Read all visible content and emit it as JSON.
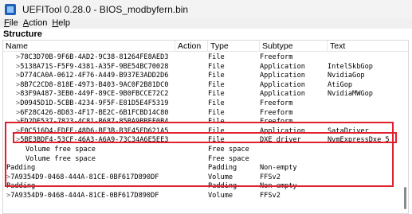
{
  "window": {
    "title": "UEFITool 0.28.0 - BIOS_modbyfern.bin"
  },
  "menu": [
    {
      "underline": "F",
      "rest": "ile"
    },
    {
      "underline": "A",
      "rest": "ction"
    },
    {
      "underline": "H",
      "rest": "elp"
    }
  ],
  "structure_label": "Structure",
  "columns": {
    "name": "Name",
    "action": "Action",
    "type": "Type",
    "subtype": "Subtype",
    "text": "Text"
  },
  "rows": [
    {
      "arrow": ">",
      "name": "78C3D70B-9F6B-4AD2-9C38-81264FE8AED3",
      "action": "",
      "type": "File",
      "subtype": "Freeform",
      "text": ""
    },
    {
      "arrow": ">",
      "name": "5138A71S-F5F9-4381-A35F-9BE54BC70028",
      "action": "",
      "type": "File",
      "subtype": "Application",
      "text": "IntelSkbGop"
    },
    {
      "arrow": ">",
      "name": "D774CA0A-0612-4F76-A449-B937E3ADD2D6",
      "action": "",
      "type": "File",
      "subtype": "Application",
      "text": "NvidiaGop"
    },
    {
      "arrow": ">",
      "name": "8B7C2CD8-818E-4973-B403-9AC0F2B81DC0",
      "action": "",
      "type": "File",
      "subtype": "Application",
      "text": "AtiGop"
    },
    {
      "arrow": ">",
      "name": "83F9A487-3EB0-449F-89CE-9B0FBCCE72C2",
      "action": "",
      "type": "File",
      "subtype": "Application",
      "text": "NvidiaMWGop"
    },
    {
      "arrow": ">",
      "name": "D0945D1D-5CBB-4234-9F5F-E81D5E4F5319",
      "action": "",
      "type": "File",
      "subtype": "Freeform",
      "text": ""
    },
    {
      "arrow": ">",
      "name": "6F28C426-8D83-4F17-BE2C-6B1FCBD14C80",
      "action": "",
      "type": "File",
      "subtype": "Freeform",
      "text": ""
    },
    {
      "arrow": ">",
      "name": "ED2DE537-7823-4C81-B687-85BA9BBEF0B4",
      "action": "",
      "type": "File",
      "subtype": "Freeform",
      "text": ""
    },
    {
      "arrow": ">",
      "name": "F0C516D4-EDFF-48D6-BF3B-B3E45FD621A5",
      "action": "",
      "type": "File",
      "subtype": "Application",
      "text": "SataDriver"
    },
    {
      "arrow": ">",
      "name": "5BE3BDF4-53CF-46A3-A6A9-73C34A6E5EE3",
      "action": "",
      "type": "File",
      "subtype": "DXE driver",
      "text": "NvmExpressDxe_5"
    },
    {
      "arrow": "",
      "name": "Volume free space",
      "action": "",
      "type": "Free space",
      "subtype": "",
      "text": ""
    },
    {
      "arrow": "",
      "name": "Volume free space",
      "action": "",
      "type": "Free space",
      "subtype": "",
      "text": ""
    },
    {
      "arrow": "",
      "name": "Padding",
      "action": "",
      "type": "Padding",
      "subtype": "Non-empty",
      "text": ""
    },
    {
      "arrow": ">",
      "name": "7A9354D9-0468-444A-81CE-0BF617D890DF",
      "action": "",
      "type": "Volume",
      "subtype": "FFSv2",
      "text": ""
    },
    {
      "arrow": "",
      "name": "Padding",
      "action": "",
      "type": "Padding",
      "subtype": "Non-empty",
      "text": ""
    },
    {
      "arrow": ">",
      "name": "7A9354D9-0468-444A-81CE-0BF617D890DF",
      "action": "",
      "type": "Volume",
      "subtype": "FFSv2",
      "text": ""
    }
  ],
  "colors": {
    "highlight": "#e0202c",
    "titlebar": "#f3f3f3",
    "menubar": "#f0f0f0"
  },
  "icons": {
    "app": "uefitool-icon",
    "expand": "chevron-right-icon"
  }
}
